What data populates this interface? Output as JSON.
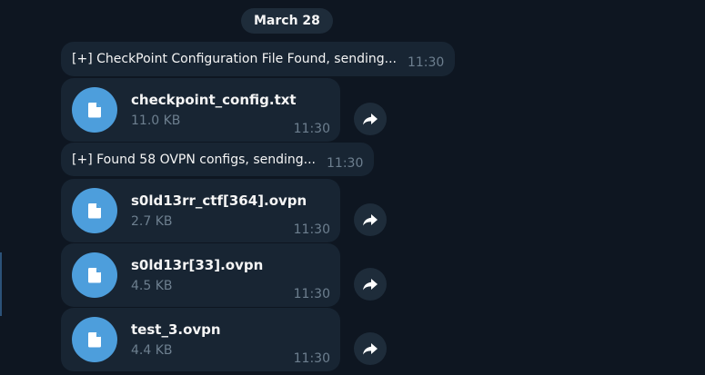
{
  "date_label": "March 28",
  "messages": [
    {
      "text": "[+] CheckPoint Configuration File Found, sending...",
      "time": "11:30"
    },
    {
      "text": "[+] Found 58 OVPN configs, sending...",
      "time": "11:30"
    }
  ],
  "files": [
    {
      "name": "checkpoint_config.txt",
      "size": "11.0 KB",
      "time": "11:30"
    },
    {
      "name": "s0ld13rr_ctf[364].ovpn",
      "size": "2.7 KB",
      "time": "11:30"
    },
    {
      "name": "s0ld13r[33].ovpn",
      "size": "4.5 KB",
      "time": "11:30"
    },
    {
      "name": "test_3.ovpn",
      "size": "4.4 KB",
      "time": "11:30"
    }
  ],
  "icons": {
    "file": "file-icon",
    "forward": "forward-icon"
  },
  "colors": {
    "background": "#0e1621",
    "bubble": "#182533",
    "accent": "#4d9edc",
    "muted": "#6d7f8f"
  }
}
